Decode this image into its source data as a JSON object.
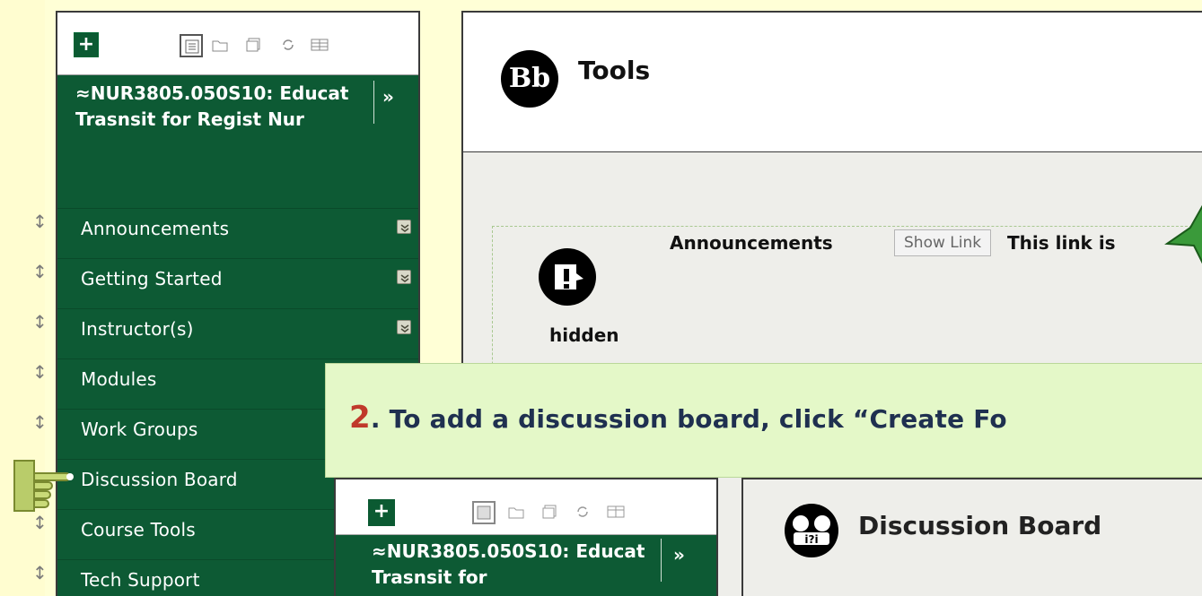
{
  "sidebar": {
    "add_label": "+",
    "course_title": "≈NUR3805.050S10: Educat Trasnsit for Regist Nur",
    "collapse_label": "»",
    "items": [
      {
        "label": "Announcements",
        "has_menu": true
      },
      {
        "label": "Getting Started",
        "has_menu": true
      },
      {
        "label": "Instructor(s)",
        "has_menu": true
      },
      {
        "label": "Modules",
        "has_menu": true
      },
      {
        "label": "Work Groups",
        "has_menu": false
      },
      {
        "label": "Discussion Board",
        "has_menu": false
      },
      {
        "label": "Course Tools",
        "has_menu": false
      },
      {
        "label": "Tech Support",
        "has_menu": false
      }
    ],
    "drag_glyph": "↕"
  },
  "content": {
    "logo_text": "Bb",
    "page_title": "Tools",
    "tool": {
      "name": "Announcements",
      "show_link_label": "Show Link",
      "hidden_text_1": "This link is",
      "hidden_text_2": "hidden"
    }
  },
  "callout": {
    "step": "2",
    "text": ". To add a discussion board, click “Create Fo"
  },
  "inset": {
    "add_label": "+",
    "course_title": "≈NUR3805.050S10: Educat Trasnsit for",
    "collapse_label": "»",
    "tool_title": "Discussion Board"
  },
  "colors": {
    "sidebar_green": "#0d5a34",
    "callout_bg": "#e4f8c8",
    "step_red": "#c0392b",
    "callout_text": "#1f3050"
  }
}
